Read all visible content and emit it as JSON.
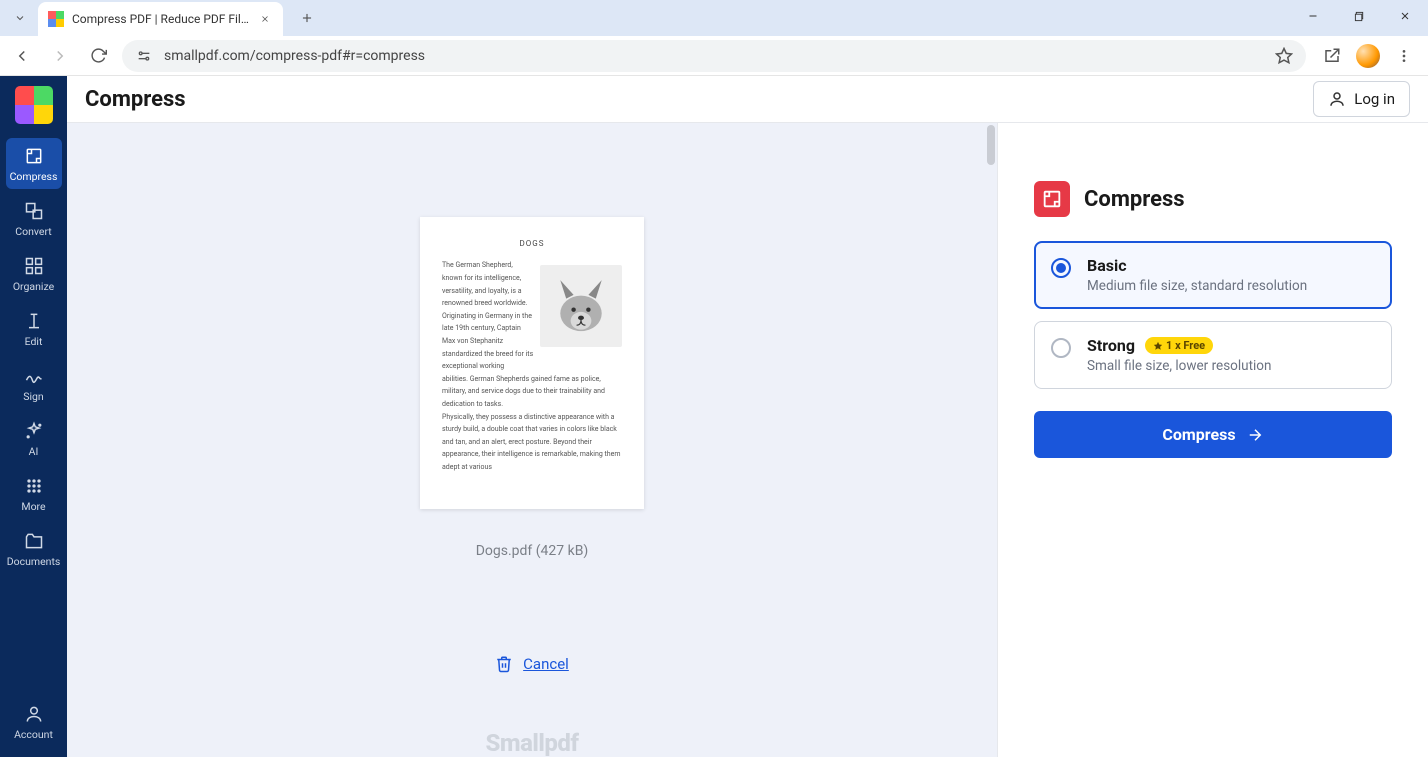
{
  "browser": {
    "tab_title": "Compress PDF | Reduce PDF Fil…",
    "url": "smallpdf.com/compress-pdf#r=compress"
  },
  "header": {
    "title": "Compress",
    "login_label": "Log in"
  },
  "rail": {
    "items": [
      {
        "label": "Compress"
      },
      {
        "label": "Convert"
      },
      {
        "label": "Organize"
      },
      {
        "label": "Edit"
      },
      {
        "label": "Sign"
      },
      {
        "label": "AI"
      },
      {
        "label": "More"
      },
      {
        "label": "Documents"
      }
    ],
    "account_label": "Account"
  },
  "document": {
    "title": "DOGS",
    "filename_line": "Dogs.pdf (427 kB)",
    "cancel_label": "Cancel",
    "brand": "Smallpdf",
    "body_lines": [
      "The German Shepherd, known for its intelligence, versatility, and loyalty, is a",
      "renowned breed worldwide. Originating in Germany in the late 19th century, Captain Max von Stephanitz standardized the breed for its exceptional working",
      "abilities. German Shepherds gained fame as police, military, and service dogs due to their trainability and dedication to tasks.",
      "Physically, they possess a distinctive appearance with a sturdy build, a double coat that varies in colors like black and tan, and an alert, erect posture. Beyond their appearance, their intelligence is remarkable, making them adept at various"
    ]
  },
  "panel": {
    "title": "Compress",
    "options": {
      "basic": {
        "title": "Basic",
        "sub": "Medium file size, standard resolution"
      },
      "strong": {
        "title": "Strong",
        "sub": "Small file size, lower resolution",
        "badge": "1 x Free"
      }
    },
    "cta": "Compress"
  }
}
